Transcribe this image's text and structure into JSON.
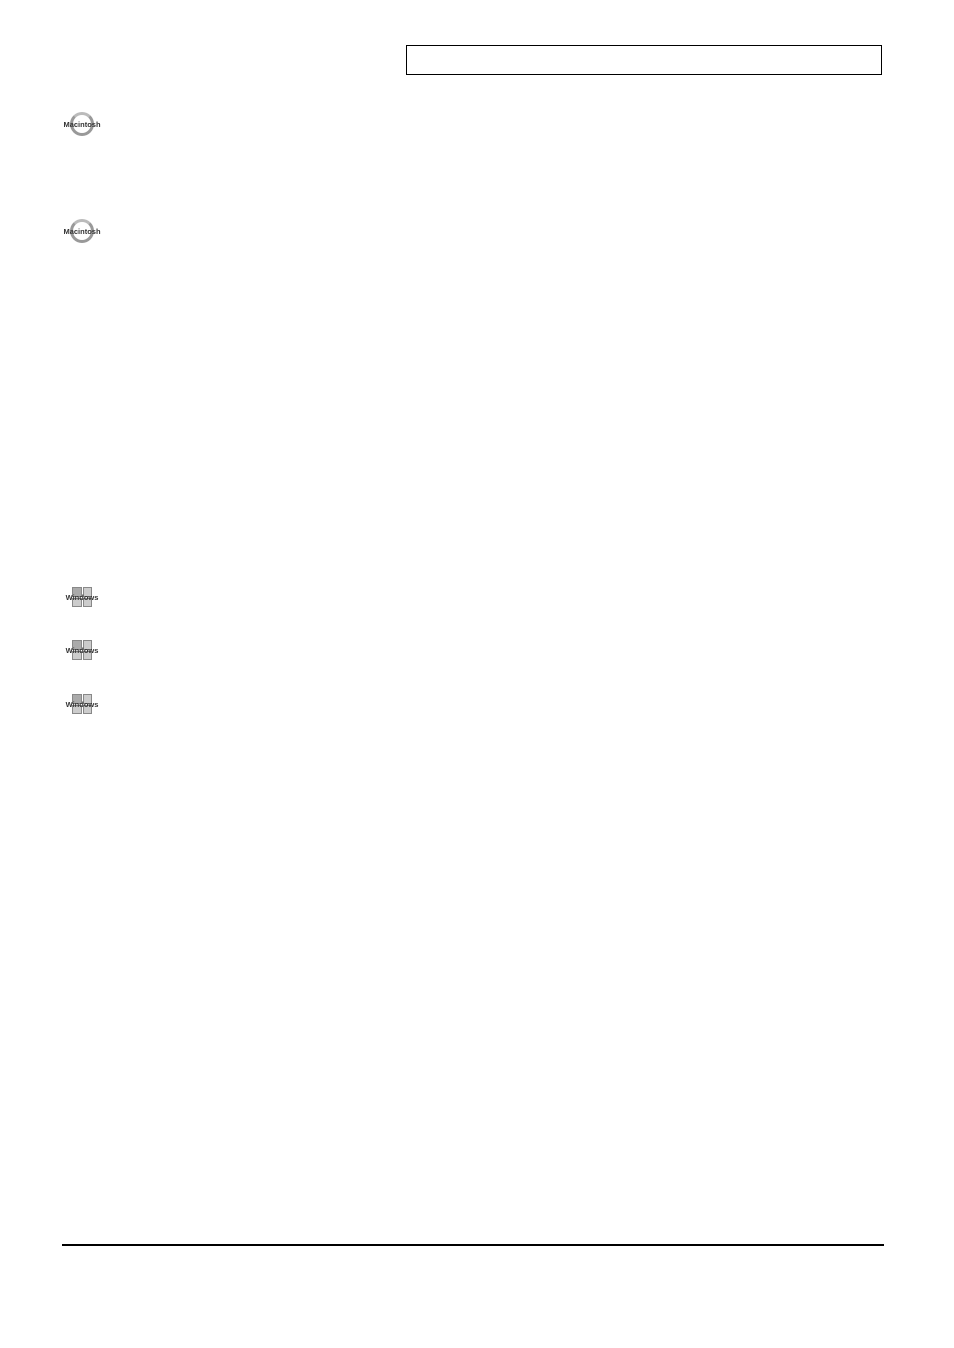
{
  "header": {
    "box_content": ""
  },
  "badges": {
    "mac_1": "Macintosh",
    "mac_2": "Macintosh",
    "win_1": "Windows",
    "win_2": "Windows",
    "win_3": "Windows"
  }
}
